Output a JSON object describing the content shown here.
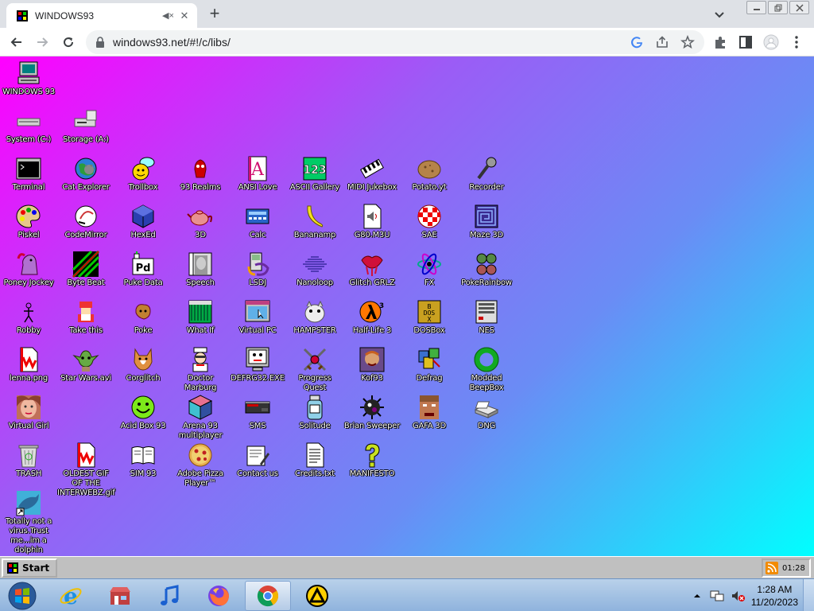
{
  "browser": {
    "tab_title": "WINDOWS93",
    "url": "windows93.net/#!/c/libs/"
  },
  "desktop_icons": [
    {
      "label": "WINDOWS 93",
      "icon": "computer-icon"
    },
    {
      "label": "System (C:)",
      "icon": "drive-icon"
    },
    {
      "label": "Storage (A:)",
      "icon": "floppy-drive-icon"
    },
    {
      "label": "Terminal",
      "icon": "terminal-icon"
    },
    {
      "label": "Cat Explorer",
      "icon": "globe-cat-icon"
    },
    {
      "label": "Trollbox",
      "icon": "chat-face-icon"
    },
    {
      "label": "93 Realms",
      "icon": "red-creature-icon"
    },
    {
      "label": "ANSI Love",
      "icon": "letter-a-icon"
    },
    {
      "label": "ASCII Gallery",
      "icon": "numbers-icon"
    },
    {
      "label": "MIDI Jukebox",
      "icon": "piano-keys-icon"
    },
    {
      "label": "Potato.yt",
      "icon": "potato-icon"
    },
    {
      "label": "Recorder",
      "icon": "microphone-icon"
    },
    {
      "label": "Piskel",
      "icon": "palette-icon"
    },
    {
      "label": "CodeMirror",
      "icon": "codemirror-icon"
    },
    {
      "label": "HexEd",
      "icon": "cube-icon"
    },
    {
      "label": "3D",
      "icon": "teapot-icon"
    },
    {
      "label": "Calc",
      "icon": "calculator-icon"
    },
    {
      "label": "Bananamp",
      "icon": "banana-icon"
    },
    {
      "label": "G80.M3U",
      "icon": "audio-file-icon"
    },
    {
      "label": "SAE",
      "icon": "checker-ball-icon"
    },
    {
      "label": "Maze 3D",
      "icon": "maze-icon"
    },
    {
      "label": "Poney Jockey",
      "icon": "pony-icon"
    },
    {
      "label": "Byte Beat",
      "icon": "bytebeat-icon"
    },
    {
      "label": "Puke Data",
      "icon": "pd-icon"
    },
    {
      "label": "Speech",
      "icon": "speech-face-icon"
    },
    {
      "label": "LSDJ",
      "icon": "gameboy-icon"
    },
    {
      "label": "Nanoloop",
      "icon": "nanoloop-icon"
    },
    {
      "label": "Glitch GRLZ",
      "icon": "lips-icon"
    },
    {
      "label": "FX",
      "icon": "atom-icon"
    },
    {
      "label": "PokeRainbow",
      "icon": "pokerainbow-icon"
    },
    {
      "label": "Robby",
      "icon": "stick-figure-icon"
    },
    {
      "label": "Take this",
      "icon": "take-this-icon"
    },
    {
      "label": "Poke",
      "icon": "poke-icon"
    },
    {
      "label": "What If",
      "icon": "whatif-icon"
    },
    {
      "label": "Virtual PC",
      "icon": "virtual-pc-icon"
    },
    {
      "label": "HAMPSTER",
      "icon": "hamster-icon"
    },
    {
      "label": "Half-Life 3",
      "icon": "lambda-icon"
    },
    {
      "label": "DOSBox",
      "icon": "dosbox-icon"
    },
    {
      "label": "NES",
      "icon": "nes-icon"
    },
    {
      "label": "lenna.png",
      "icon": "image-file-icon"
    },
    {
      "label": "Star Wars.avi",
      "icon": "yoda-icon"
    },
    {
      "label": "Corglitch",
      "icon": "corgi-icon"
    },
    {
      "label": "Doctor Marburg",
      "icon": "doctor-icon"
    },
    {
      "label": "DEFRG32.EXE",
      "icon": "defrag-monitor-icon"
    },
    {
      "label": "Progress Quest",
      "icon": "swords-icon"
    },
    {
      "label": "Kof93",
      "icon": "fighter-icon"
    },
    {
      "label": "Defrag",
      "icon": "defrag-icon"
    },
    {
      "label": "Modded BeepBox",
      "icon": "ring-icon"
    },
    {
      "label": "Virtual Girl",
      "icon": "girl-face-icon"
    },
    {
      "label": "Acid Box 93",
      "icon": "smiley-icon"
    },
    {
      "label": "Arena 93 multiplayer",
      "icon": "arena-cube-icon"
    },
    {
      "label": "SMS",
      "icon": "sms-console-icon"
    },
    {
      "label": "Solitude",
      "icon": "solitude-icon"
    },
    {
      "label": "Brian Sweeper",
      "icon": "mine-icon"
    },
    {
      "label": "GAFA 3D",
      "icon": "doomguy-icon"
    },
    {
      "label": "DNG",
      "icon": "dng-icon"
    },
    {
      "label": "TRASH",
      "icon": "trash-icon"
    },
    {
      "label": "OLDEST GIF OF THE INTERWEBZ.gif",
      "icon": "gif-file-icon"
    },
    {
      "label": "SIM 93",
      "icon": "book-icon"
    },
    {
      "label": "Adobe Pizza Player™",
      "icon": "pizza-icon"
    },
    {
      "label": "Contact us",
      "icon": "contact-icon"
    },
    {
      "label": "Credits.txt",
      "icon": "text-file-icon"
    },
    {
      "label": "MANIFESTO",
      "icon": "question-mark-icon"
    },
    {
      "label": "Totally not a virus.Trust me...im a dolphin",
      "icon": "dolphin-icon"
    }
  ],
  "w93_taskbar": {
    "start_label": "Start",
    "tray_time": "01:28"
  },
  "windows_taskbar": {
    "time": "1:28 AM",
    "date": "11/20/2023",
    "apps": [
      {
        "name": "internet-explorer"
      },
      {
        "name": "store"
      },
      {
        "name": "music"
      },
      {
        "name": "firefox"
      },
      {
        "name": "chrome",
        "active": true
      },
      {
        "name": "other-app"
      }
    ]
  }
}
